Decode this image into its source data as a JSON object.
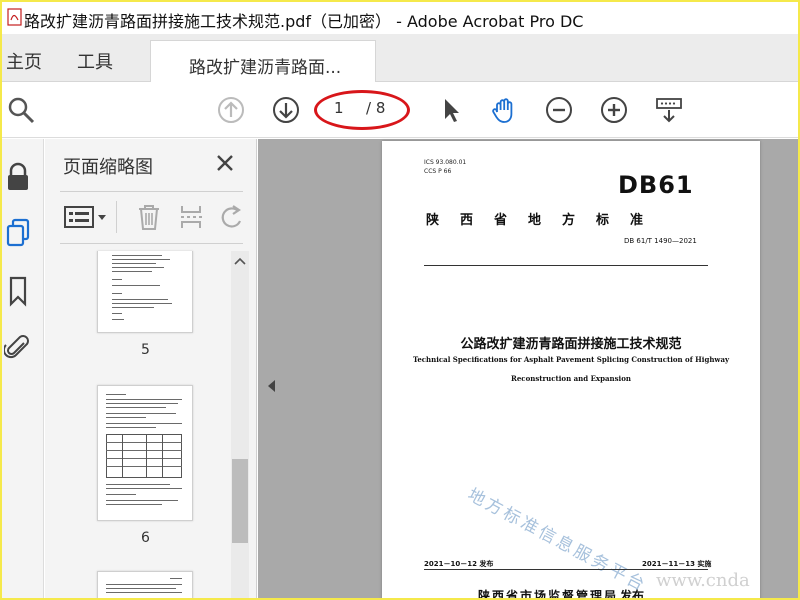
{
  "window": {
    "title": "路改扩建沥青路面拼接施工技术规范.pdf（已加密） - Adobe Acrobat Pro DC"
  },
  "menu": {
    "home": "主页",
    "tools": "工具",
    "doc_tab": "路改扩建沥青路面..."
  },
  "toolbar": {
    "page_current": "1",
    "page_total": "/ 8"
  },
  "thumbnails_panel": {
    "title": "页面缩略图",
    "pages": [
      {
        "label": "5"
      },
      {
        "label": "6"
      }
    ]
  },
  "document": {
    "code_line1": "ICS 93.080.01",
    "code_line2": "CCS  P 66",
    "std_code": "DB61",
    "province": "陕西省地方标准",
    "std_number": "DB 61/T 1490—2021",
    "title_cn": "公路改扩建沥青路面拼接施工技术规范",
    "title_en_line1": "Technical Specifications for Asphalt Pavement Splicing Construction of Highway",
    "title_en_line2": "Reconstruction and Expansion",
    "watermark": "地方标准信息服务平台",
    "date_published": "2021－10－12 发布",
    "date_implemented": "2021－11－13 实施",
    "issuer": "陕西省市场监督管理局",
    "issue_word": "发布"
  },
  "site_watermark": "www.cnda",
  "colors": {
    "frame": "#f5e94b",
    "accent_blue": "#1c6fd1",
    "annotation_red": "#d8161a",
    "doc_background": "#a9a9a9"
  }
}
